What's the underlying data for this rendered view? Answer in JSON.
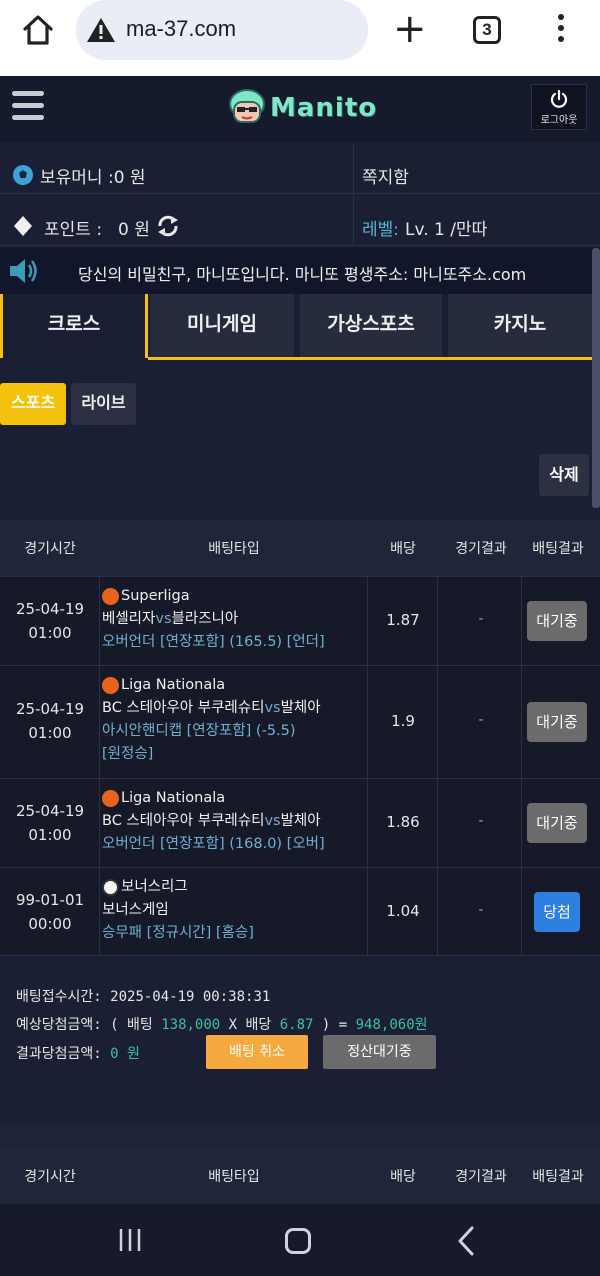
{
  "browser": {
    "url": "ma-37.com",
    "tab_count": "3"
  },
  "header": {
    "logo_text": "Manito",
    "logout_label": "로그아웃"
  },
  "account": {
    "money_label": "보유머니 :0 원",
    "messages_label": "쪽지함",
    "points_label": "포인트 :",
    "points_value": "0 원",
    "level_label": "레벨:",
    "level_value": "Lv. 1 /만따"
  },
  "notice": {
    "text": "당신의 비밀친구, 마니또입니다. 마니또 평생주소: 마니또주소.com"
  },
  "tabs": [
    {
      "label": "크로스",
      "active": true
    },
    {
      "label": "미니게임",
      "active": false
    },
    {
      "label": "가상스포츠",
      "active": false
    },
    {
      "label": "카지노",
      "active": false
    }
  ],
  "subtabs": {
    "sports": "스포츠",
    "live": "라이브"
  },
  "delete_label": "삭제",
  "table": {
    "headers": [
      "경기시간",
      "배팅타입",
      "배당",
      "경기결과",
      "배팅결과"
    ],
    "rows": [
      {
        "date": "25-04-19",
        "time": "01:00",
        "sport": "basketball",
        "league": "Superliga",
        "home": "베셀리자",
        "vs": "vs",
        "away": "블라즈니아",
        "type_lines": [
          "오버언더 [연장포함] (165.5) [언더]"
        ],
        "odds": "1.87",
        "result": "-",
        "status": "대기중"
      },
      {
        "date": "25-04-19",
        "time": "01:00",
        "sport": "basketball",
        "league": "Liga Nationala",
        "home": "BC 스테아우아 부쿠레슈티",
        "vs": "vs",
        "away": "발체아",
        "type_lines": [
          "아시안핸디캡 [연장포함] (-5.5)",
          "[원정승]"
        ],
        "odds": "1.9",
        "result": "-",
        "status": "대기중"
      },
      {
        "date": "25-04-19",
        "time": "01:00",
        "sport": "basketball",
        "league": "Liga Nationala",
        "home": "BC 스테아우아 부쿠레슈티",
        "vs": "vs",
        "away": "발체아",
        "type_lines": [
          "오버언더 [연장포함] (168.0) [오버]"
        ],
        "odds": "1.86",
        "result": "-",
        "status": "대기중"
      },
      {
        "date": "99-01-01",
        "time": "00:00",
        "sport": "soccer",
        "league": "보너스리그",
        "home": "보너스게임",
        "vs": "",
        "away": "",
        "type_lines": [
          "승무패 [정규시간] [홈승]"
        ],
        "odds": "1.04",
        "result": "-",
        "status": "당첨"
      }
    ]
  },
  "summary": {
    "bet_time_label": "배팅접수시간:",
    "bet_time_value": "2025-04-19 00:38:31",
    "expected_label": "예상당첨금액:",
    "expected_open": "( 배팅",
    "bet_amount": "138,000",
    "x_label": "X 배당",
    "total_odds": "6.87",
    "close_eq": ") =",
    "expected_value": "948,060원",
    "result_label": "결과당첨금액:",
    "result_value": "0 원",
    "cancel_label": "배팅 취소",
    "pending_label": "정산대기중"
  },
  "table2": {
    "headers": [
      "경기시간",
      "배팅타입",
      "배당",
      "경기결과",
      "배팅결과"
    ]
  },
  "colors": {
    "accent": "#f4c20d",
    "bg": "#1a1f33",
    "win": "#2d7fe0",
    "highlight": "#3cc0a0"
  }
}
